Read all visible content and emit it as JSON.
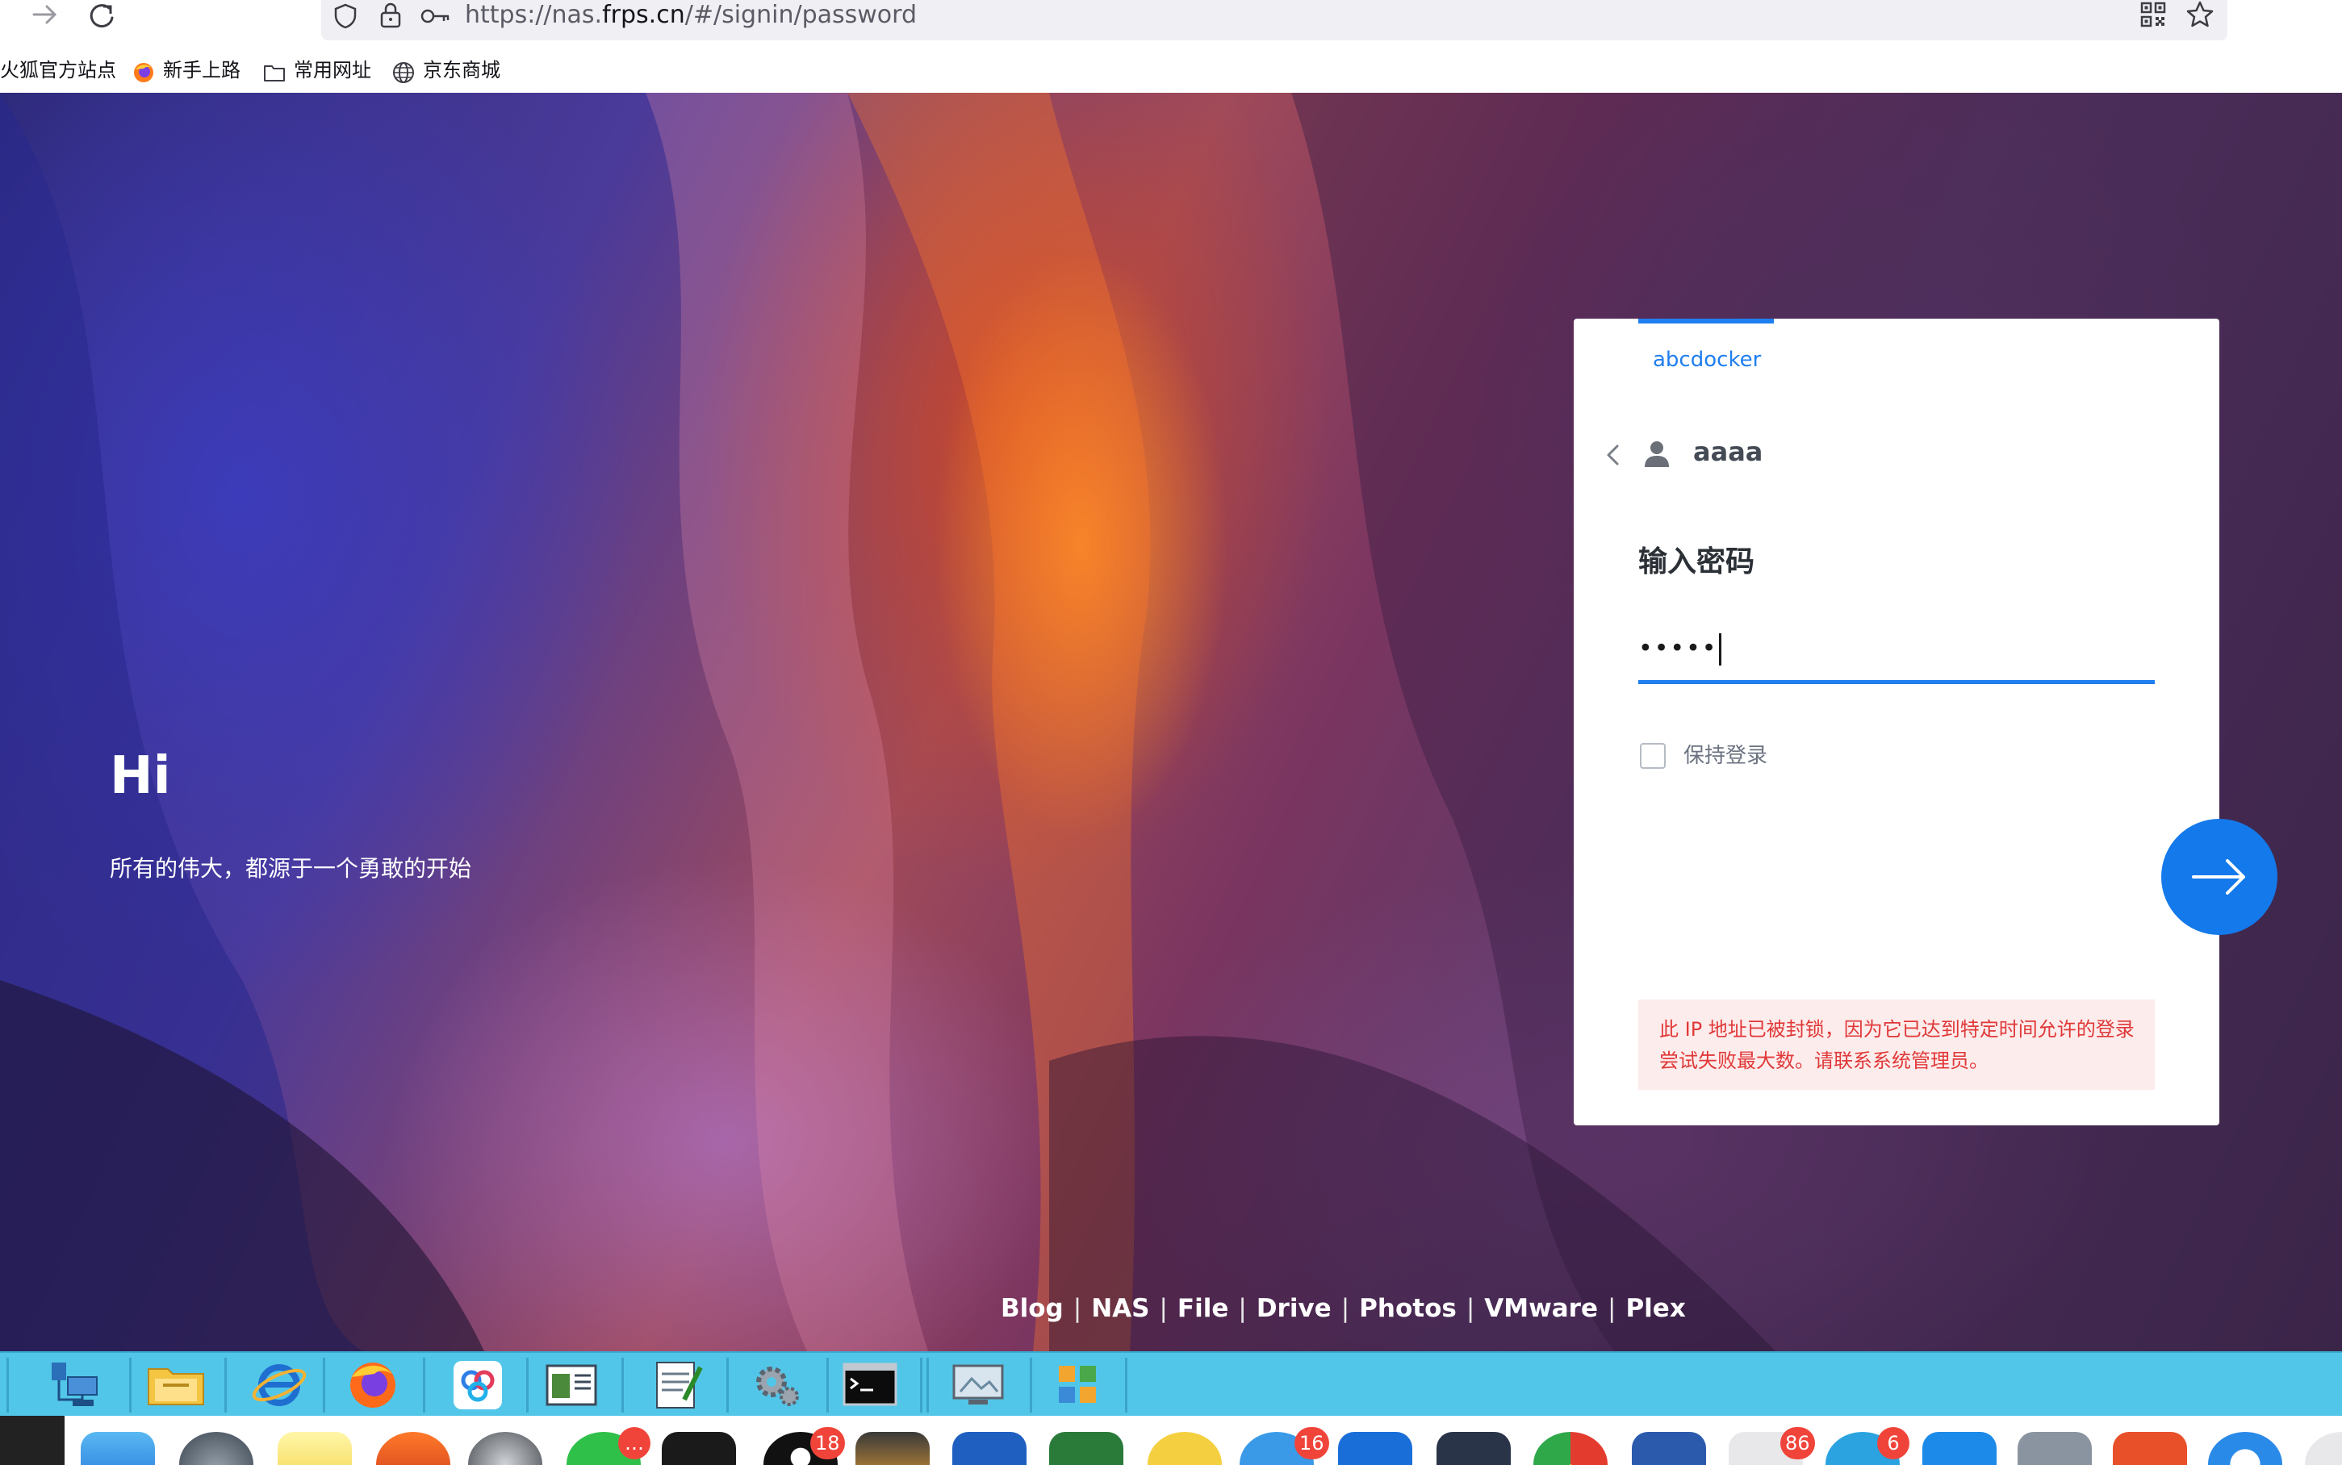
{
  "browser": {
    "url_prefix": "https://nas.",
    "url_host": "frps.cn",
    "url_suffix": "/#/signin/password",
    "bookmarks": [
      {
        "label": "火狐官方站点",
        "icon": "firefox-icon"
      },
      {
        "label": "新手上路",
        "icon": "firefox-icon"
      },
      {
        "label": "常用网址",
        "icon": "folder-icon"
      },
      {
        "label": "京东商城",
        "icon": "globe-icon"
      }
    ]
  },
  "greeting": {
    "title": "Hi",
    "subtitle": "所有的伟大，都源于一个勇敢的开始"
  },
  "login": {
    "tab_label": "abcdocker",
    "username": "aaaa",
    "password_title": "输入密码",
    "password_masked": "•••••",
    "keep_signed_in_label": "保持登录",
    "keep_signed_in_checked": false,
    "error_message": "此 IP 地址已被封锁，因为它已达到特定时间允许的登录尝试失败最大数。请联系系统管理员。"
  },
  "footer_links": [
    "Blog",
    "NAS",
    "File",
    "Drive",
    "Photos",
    "VMware",
    "Plex"
  ],
  "taskbar": {
    "quick_launch_icons": [
      "network-icon",
      "file-explorer-icon",
      "internet-explorer-icon",
      "firefox-icon",
      "baidu-netdisk-icon",
      "window-icon",
      "notepad-icon",
      "settings-gear-icon",
      "command-prompt-icon",
      "monitor-icon",
      "app-grid-icon"
    ],
    "dock_badges": {
      "chat": "…",
      "qq": "18",
      "browser": "16",
      "mail": "86",
      "telegram": "6"
    }
  },
  "colors": {
    "accent": "#1f7ef0",
    "submit_button": "#1479ea",
    "error_text": "#e03838",
    "error_background": "#fdecec",
    "quick_launch_bar": "#52c6e8"
  }
}
